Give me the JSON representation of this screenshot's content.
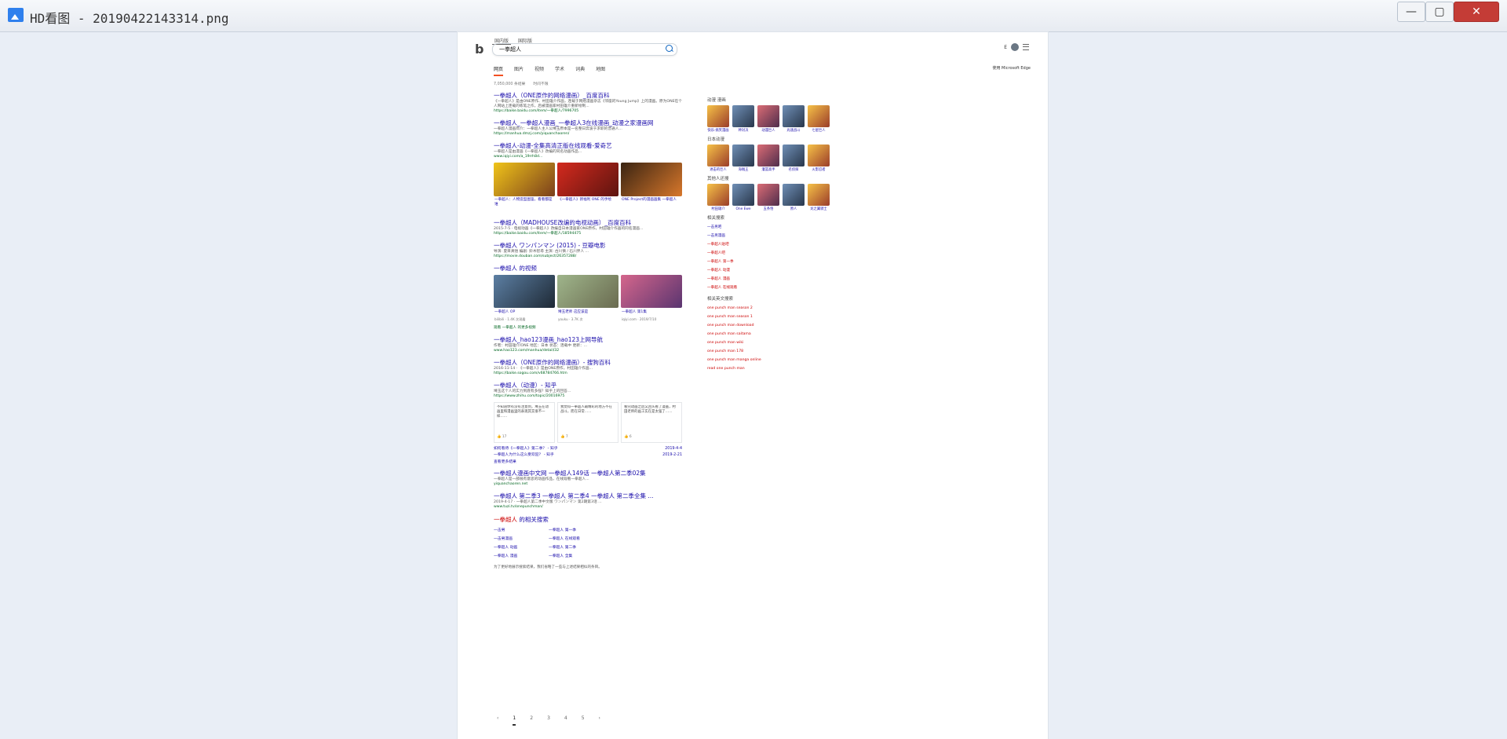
{
  "window": {
    "title": "HD看图 - 20190422143314.png",
    "buttons": {
      "minimize": "—",
      "maximize": "▢",
      "close": "✕"
    }
  },
  "search": {
    "query": "一拳超人",
    "scopes": [
      "国内版",
      "国际版"
    ],
    "header_right_text": "E",
    "tabs": [
      "网页",
      "图片",
      "视频",
      "学术",
      "词典",
      "地图"
    ],
    "edge_tip": "使用 Microsoft Edge"
  },
  "stats": {
    "count": "7,050,000 条结果",
    "time_filter": "时间不限"
  },
  "results": [
    {
      "title": "一拳超人（ONE原作的网络漫画）_百度百科",
      "snippet": "《一拳超人》是由ONE原作、村田雄介作画，连载于网络漫画杂志《邻座的Young Jump》上的漫画。原为ONE在个人网站上连载的练笔之作，后被漫画家村田雄介重新绘制...",
      "url": "https://baike.baidu.com/item/一拳超人/7996705"
    },
    {
      "title": "一拳超人_一拳超人漫画_一拳超人3在线漫画_动漫之家漫画网",
      "snippet": "一拳超人漫画简介：一拳超人主人公埼玉原本是一名整日奔波于求职的普通人...",
      "url": "https://manhua.dmzj.com/yiquanchaoren/"
    },
    {
      "title": "一拳超人-动漫-全集高清正版在线观看-爱奇艺",
      "snippet": "一拳超人是由漫画《一拳超人》改编的同名动画作品...",
      "url": "www.iqiyi.com/a_19rrh8d..."
    }
  ],
  "image_cards": [
    {
      "caption": "一拳超人：人物造型图鉴，看看都是谁"
    },
    {
      "caption": "《一拳超人》新福利 ONE 的手绘"
    },
    {
      "caption": "ONE Project的漫画画集 一拳超人"
    }
  ],
  "results2": [
    {
      "title": "一拳超人（MADHOUSE改编的电视动画）_百度百科",
      "snippet": "2015-7-5 · 电视动画《一拳超人》改编自日本漫画家ONE原作，村田雄介作画的同名漫画...",
      "url": "https://baike.baidu.com/item/一拳超人/18594475"
    },
    {
      "title": "一拳超人 ワンパンマン (2015) - 豆瓣电影",
      "snippet": "导演: 夏目真悟  编剧: 鈴木智尋  主演: 古川慎 / 石川界人 ...",
      "url": "https://movie.douban.com/subject/26357288/"
    }
  ],
  "videos": {
    "heading": "一拳超人 的视频",
    "items": [
      {
        "caption": "一拳超人 OP",
        "meta": "bilibili · 1.4K 次观看"
      },
      {
        "caption": "埼玉老师 这应该是 ",
        "meta": "youku · 3.7K 次"
      },
      {
        "caption": "一拳超人 第1集",
        "meta": "iqiyi.com · 2019/7/10"
      }
    ],
    "more": "观看 一拳超人 的更多视频"
  },
  "results3": [
    {
      "title": "一拳超人_hao123漫画_hao123上网导航",
      "snippet": "作者：村田雄介/ONE 地区：日本 状态：连载中 更新：...",
      "url": "www.hao123.com/manhua/detail/32"
    },
    {
      "title": "一拳超人（ONE原作的网络漫画）- 搜狗百科",
      "snippet": "2016-11-14 · 《一拳超人》是由ONE原作，村田雄介作画...",
      "url": "https://baike.sogou.com/v68784766.htm"
    },
    {
      "title": "一拳超人（动漫）- 知乎",
      "snippet": "埼玉这个人的实力到底有多强？知乎上的回答...",
      "url": "https://www.zhihu.com/topic/20016975"
    }
  ],
  "zhihu_cards": [
    {
      "text": "不知道你有没有注意到，埼玉在动画里和漫画里的表现其实很不一样……",
      "votes": "👍 17"
    },
    {
      "text": "我觉得一拳超人最精彩的地方不在战斗，而在日常……",
      "votes": "👍 7"
    },
    {
      "text": "看完动画之后又回头看了漫画，村田老师的画工实在是太强了……",
      "votes": "👍 6"
    }
  ],
  "zhihu_questions": [
    {
      "q": "如何看待《一拳超人》第二季？ - 知乎",
      "date": "2019-4-4"
    },
    {
      "q": "一拳超人为什么这么受欢迎？ - 知乎",
      "date": "2019-2-21"
    }
  ],
  "zhihu_more": "查看更多结果",
  "results4": [
    {
      "title": "一拳超人漫画中文网 一拳超人149话 一拳超人第二季02集",
      "snippet": "一拳超人是一部很有意思的动画作品，在线观看一拳超人...",
      "url": "yiquanchaoren.net"
    },
    {
      "title": "一拳超人 第二季3 一拳超人 第二季4 一拳超人 第二季全集 ...",
      "snippet": "2019-4-17 · 一拳超人第二季中文版 ワンパンマン 第2期第3话 ...",
      "url": "www.tuzi.tv/onepunchman/"
    }
  ],
  "related_bottom": {
    "title_red": "一拳超人",
    "title_suffix": " 的相关搜索",
    "items": [
      "一击男",
      "一拳超人 第一季",
      "一击男漫画",
      "一拳超人 在线观看",
      "一拳超人 动画",
      "一拳超人 第二季",
      "一拳超人 漫画",
      "一拳超人 全集"
    ]
  },
  "page_note": "为了更好地展示搜索结果，我们省略了一些与上述结果相似的条目。",
  "pagination": [
    "‹",
    "1",
    "2",
    "3",
    "4",
    "5",
    "›"
  ],
  "sidebar": {
    "sec1": "动漫 漫画",
    "row1": [
      "快乐·搞笑漫画",
      "神对决",
      "动漫巨人",
      "光速战斗",
      "七星巨人"
    ],
    "sec2": "日本动漫",
    "row2": [
      "进击的巨人",
      "海贼王",
      "灌篮高手",
      "名侦探",
      "火影忍者"
    ],
    "sec3": "其他人还搜",
    "row3": [
      "村田雄介",
      "One Ewe",
      "五条悟",
      "原人",
      "龙之翼骑士"
    ],
    "sec4": "相关搜索",
    "links": [
      "一击男吧",
      "一击男漫画",
      "一拳超人贴吧",
      "一拳超人吧",
      "一拳超人 第一季",
      "一拳超人 动漫",
      "一拳超人 漫画",
      "一拳超人 在线观看"
    ],
    "sec5": "相关英文搜索",
    "english": [
      "one punch man season 2",
      "one punch man season 1",
      "one punch man download",
      "one punch man saitama",
      "one punch man wiki",
      "one punch man 178",
      "one punch man manga online",
      "read one punch man"
    ]
  },
  "colors": {
    "link": "#1a0dab",
    "url": "#006621",
    "accent": "#f25022",
    "highlight": "#c00000"
  }
}
